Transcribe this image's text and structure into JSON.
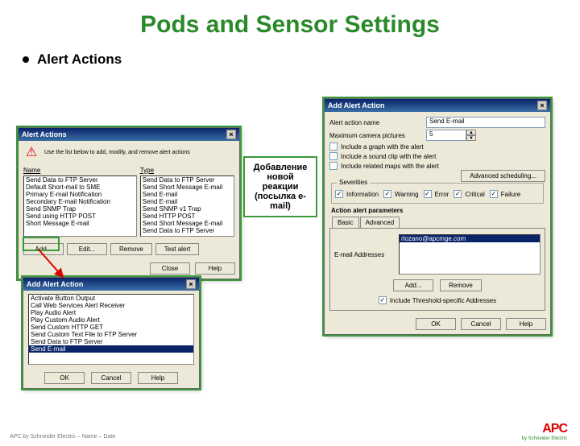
{
  "slide": {
    "title": "Pods and Sensor Settings",
    "bullet": "Alert Actions",
    "footer": "APC by Schneider Electric – Name – Date",
    "logo_main": "APC",
    "logo_sub": "by Schneider Electric"
  },
  "callout": {
    "text_l1": "Добавление",
    "text_l2": "новой",
    "text_l3": "реакции",
    "text_l4": "(посылка e-",
    "text_l5": "mail)"
  },
  "win1": {
    "title": "Alert Actions",
    "warning": "Use the list below to add, modify, and remove alert actions",
    "col1": "Name",
    "col2": "Type",
    "rows": [
      {
        "n": "Send Data to FTP Server",
        "t": "Send Data to FTP Server"
      },
      {
        "n": "Default Short-mail to SME",
        "t": "Send Short Message E-mail"
      },
      {
        "n": "Primary E-mail Notification",
        "t": "Send E-mail"
      },
      {
        "n": "Secondary E-mail Notification",
        "t": "Send E-mail"
      },
      {
        "n": "Send SNMP Trap",
        "t": "Send SNMP v1 Trap"
      },
      {
        "n": "Send using HTTP POST",
        "t": "Send HTTP POST"
      },
      {
        "n": "Short Message E-mail",
        "t": "Send Short Message E-mail"
      },
      {
        "n": "",
        "t": "Send Data to FTP Server"
      }
    ],
    "btn_add": "Add...",
    "btn_edit": "Edit...",
    "btn_remove": "Remove",
    "btn_test": "Test alert",
    "btn_close": "Close",
    "btn_help": "Help"
  },
  "win2": {
    "title": "Add Alert Action",
    "items": [
      "Activate Button Output",
      "Call Web Services Alert Receiver",
      "Play Audio Alert",
      "Play Custom Audio Alert",
      "Send Custom HTTP GET",
      "Send Custom Text File to FTP Server",
      "Send Data to FTP Server",
      "Send E-mail"
    ],
    "selected_index": 7,
    "btn_ok": "OK",
    "btn_cancel": "Cancel",
    "btn_help": "Help"
  },
  "win3": {
    "title": "Add Alert Action",
    "lbl_action_name": "Alert action name",
    "val_action_name": "Send E-mail",
    "lbl_max_pics": "Maximum camera pictures",
    "val_max_pics": "5",
    "chk_graph": "Include a graph with the alert",
    "chk_sound": "Include a sound clip with the alert",
    "chk_maps": "Include related maps with the alert",
    "btn_sched": "Advanced scheduling...",
    "grp_sev": "Severities",
    "sev": [
      "Information",
      "Warning",
      "Error",
      "Critical",
      "Failure"
    ],
    "lbl_params": "Action alert parameters",
    "tab_basic": "Basic",
    "tab_adv": "Advanced",
    "lbl_email": "E-mail Addresses",
    "val_email": "rlozano@apcmge.com",
    "btn_add": "Add...",
    "btn_remove": "Remove",
    "chk_threshold": "Include Threshold-specific Addresses",
    "btn_ok": "OK",
    "btn_cancel": "Cancel",
    "btn_help": "Help"
  }
}
